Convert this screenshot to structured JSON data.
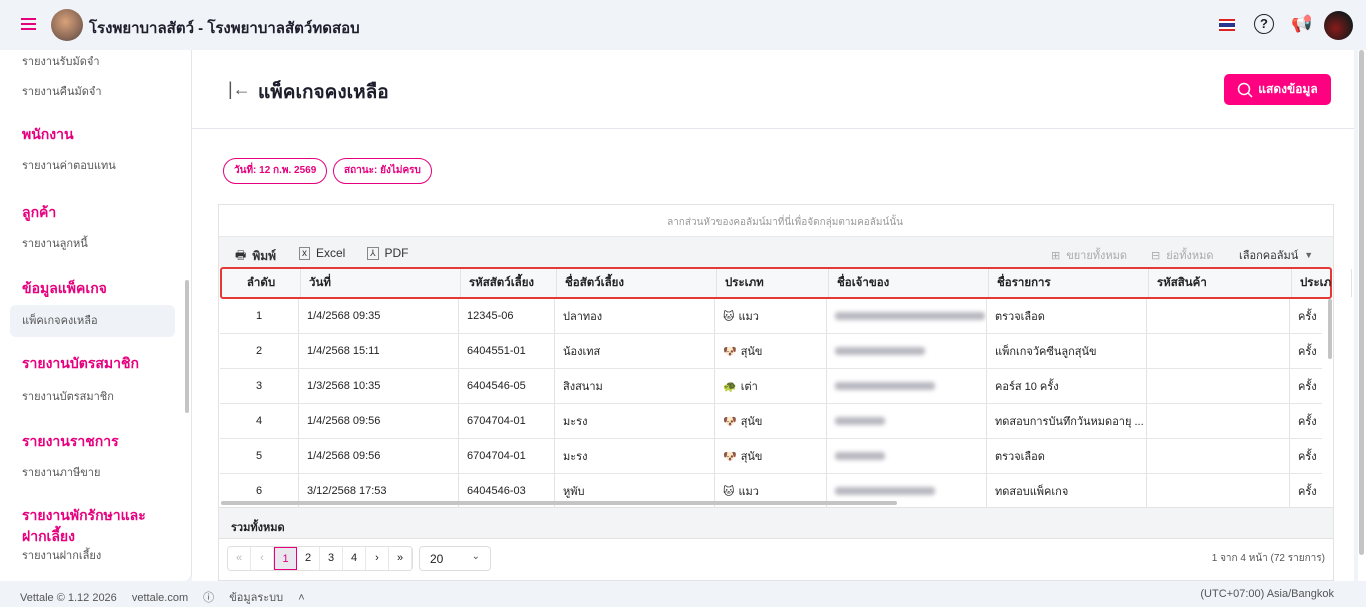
{
  "app": {
    "title": "โรงพยาบาลสัตว์ - โรงพยาบาลสัตว์ทดสอบ"
  },
  "sidebar": {
    "items": [
      {
        "type": "item",
        "label": "รายงานรับมัดจำ"
      },
      {
        "type": "item",
        "label": "รายงานคืนมัดจำ"
      },
      {
        "type": "head",
        "label": "พนักงาน"
      },
      {
        "type": "item",
        "label": "รายงานค่าตอบแทน"
      },
      {
        "type": "head",
        "label": "ลูกค้า"
      },
      {
        "type": "item",
        "label": "รายงานลูกหนี้"
      },
      {
        "type": "head",
        "label": "ข้อมูลแพ็คเกจ"
      },
      {
        "type": "item",
        "label": "แพ็คเกจคงเหลือ",
        "active": true
      },
      {
        "type": "head",
        "label": "รายงานบัตรสมาชิก"
      },
      {
        "type": "item",
        "label": "รายงานบัตรสมาชิก"
      },
      {
        "type": "head",
        "label": "รายงานราชการ"
      },
      {
        "type": "item",
        "label": "รายงานภาษีขาย"
      },
      {
        "type": "head",
        "label": "รายงานพักรักษาและฝากเลี้ยง"
      },
      {
        "type": "item",
        "label": "รายงานฝากเลี้ยง"
      }
    ]
  },
  "page": {
    "title": "แพ็คเกจคงเหลือ",
    "show_button": "แสดงข้อมูล",
    "chips": [
      "วันที่: 12 ก.พ. 2569",
      "สถานะ: ยังไม่ครบ"
    ]
  },
  "grid": {
    "group_hint": "ลากส่วนหัวของคอลัมน์มาที่นี่เพื่อจัดกลุ่มตามคอลัมน์นั้น",
    "toolbar": {
      "print": "พิมพ์",
      "excel": "Excel",
      "pdf": "PDF",
      "expand_all": "ขยายทั้งหมด",
      "collapse_all": "ย่อทั้งหมด",
      "choose_columns": "เลือกคอลัมน์"
    },
    "columns": [
      "ลำดับ",
      "วันที่",
      "รหัสสัตว์เลี้ยง",
      "ชื่อสัตว์เลี้ยง",
      "ประเภท",
      "ชื่อเจ้าของ",
      "ชื่อรายการ",
      "รหัสสินค้า",
      "ประเภ"
    ],
    "rows": [
      {
        "no": "1",
        "date": "1/4/2568 09:35",
        "pet_id": "12345-06",
        "pet": "ปลาทอง",
        "icon": "🐱",
        "type": "แมว",
        "item": "ตรวจเลือด",
        "sku": "",
        "unit": "ครั้ง"
      },
      {
        "no": "2",
        "date": "1/4/2568 15:11",
        "pet_id": "6404551-01",
        "pet": "น้องเทส",
        "icon": "🐶",
        "type": "สุนัข",
        "item": "แพ็กเกจวัคซีนลูกสุนัข",
        "sku": "",
        "unit": "ครั้ง"
      },
      {
        "no": "3",
        "date": "1/3/2568 10:35",
        "pet_id": "6404546-05",
        "pet": "สิงสนาม",
        "icon": "🐢",
        "type": "เต่า",
        "item": "คอร์ส 10 ครั้ง",
        "sku": "",
        "unit": "ครั้ง"
      },
      {
        "no": "4",
        "date": "1/4/2568 09:56",
        "pet_id": "6704704-01",
        "pet": "มะรง",
        "icon": "🐶",
        "type": "สุนัข",
        "item": "ทดสอบการบันทึกวันหมดอายุ ...",
        "sku": "",
        "unit": "ครั้ง"
      },
      {
        "no": "5",
        "date": "1/4/2568 09:56",
        "pet_id": "6704704-01",
        "pet": "มะรง",
        "icon": "🐶",
        "type": "สุนัข",
        "item": "ตรวจเลือด",
        "sku": "",
        "unit": "ครั้ง"
      },
      {
        "no": "6",
        "date": "3/12/2568 17:53",
        "pet_id": "6404546-03",
        "pet": "หูพับ",
        "icon": "🐱",
        "type": "แมว",
        "item": "ทดสอบแพ็คเกจ",
        "sku": "",
        "unit": "ครั้ง"
      }
    ],
    "summary": "รวมทั้งหมด",
    "pager": {
      "first": "«",
      "prev": "‹",
      "pages": [
        "1",
        "2",
        "3",
        "4"
      ],
      "next": "›",
      "last": "»",
      "current": 1,
      "page_size": "20",
      "info": "1 จาก 4 หน้า (72 รายการ)"
    }
  },
  "footer": {
    "version": "Vettale © 1.12 2026",
    "site": "vettale.com",
    "sysinfo": "ข้อมูลระบบ",
    "timezone": "(UTC+07:00) Asia/Bangkok"
  }
}
